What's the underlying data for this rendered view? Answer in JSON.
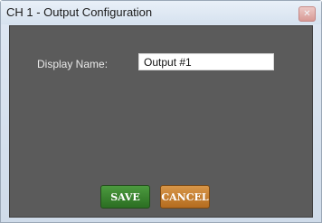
{
  "window": {
    "title": "CH 1 - Output Configuration",
    "close_glyph": "✕"
  },
  "form": {
    "display_name_label": "Display Name:",
    "display_name_value": "Output #1"
  },
  "buttons": {
    "save": "SAVE",
    "cancel": "CANCEL"
  },
  "colors": {
    "panel": "#5b5b5b",
    "save": "#3a8431",
    "cancel": "#c7802f"
  }
}
